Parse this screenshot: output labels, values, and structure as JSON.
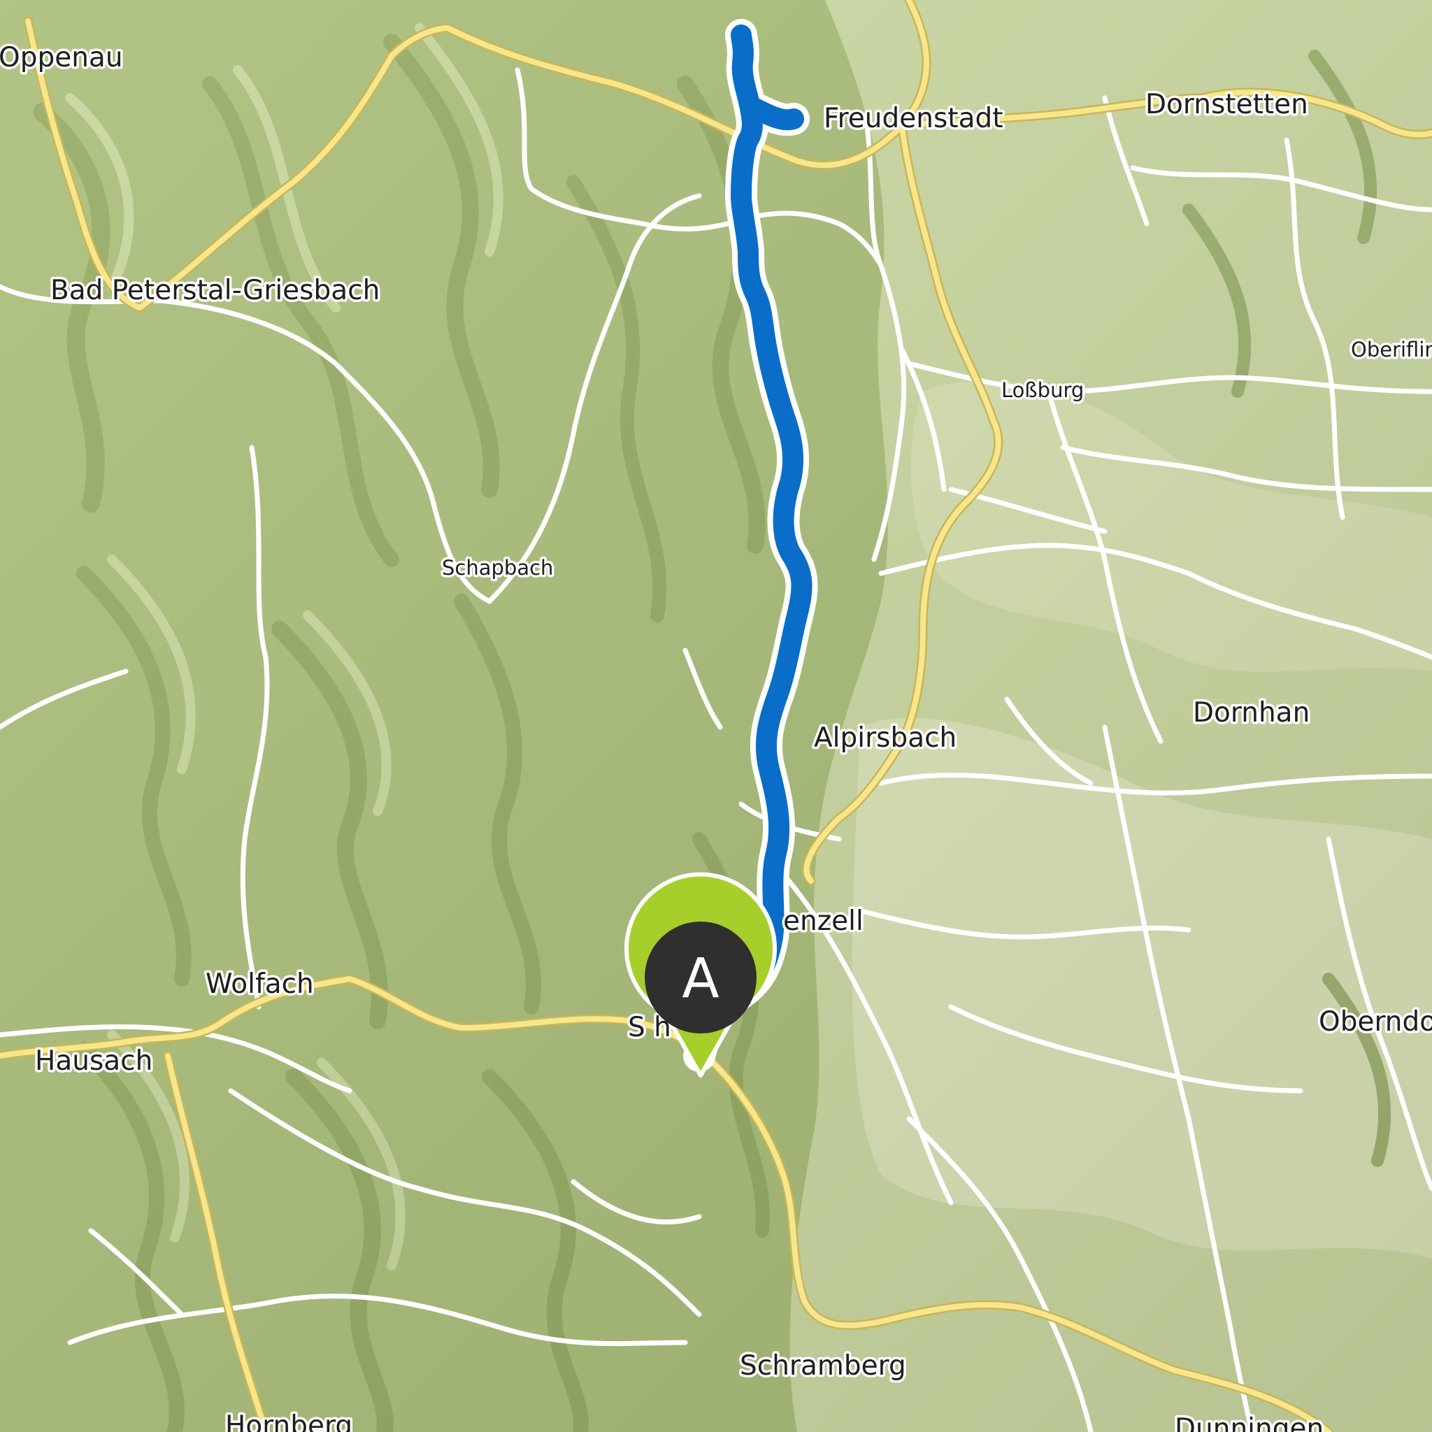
{
  "map": {
    "places": [
      {
        "id": "oppenau",
        "name": "Oppenau"
      },
      {
        "id": "freudenstadt",
        "name": "Freudenstadt"
      },
      {
        "id": "dornstetten",
        "name": "Dornstetten"
      },
      {
        "id": "bad-peterstal",
        "name": "Bad Peterstal-Griesbach"
      },
      {
        "id": "obeiflin",
        "name": "Oberiflin"
      },
      {
        "id": "lossburg",
        "name": "Loßburg"
      },
      {
        "id": "schapbach",
        "name": "Schapbach"
      },
      {
        "id": "dornhan",
        "name": "Dornhan"
      },
      {
        "id": "alpirsbach",
        "name": "Alpirsbach"
      },
      {
        "id": "ehlenzell",
        "name": "enzell"
      },
      {
        "id": "wolfach",
        "name": "Wolfach"
      },
      {
        "id": "schiltach",
        "name": "S          h"
      },
      {
        "id": "hausach",
        "name": "Hausach"
      },
      {
        "id": "oberndorf",
        "name": "Oberndo"
      },
      {
        "id": "schramberg",
        "name": "Schramberg"
      },
      {
        "id": "hornberg",
        "name": "Hornberg"
      },
      {
        "id": "dunningen",
        "name": "Dunningen"
      }
    ],
    "route": {
      "color": "#0a6ec9",
      "outline": "#ffffff"
    },
    "start_marker": {
      "letter": "A",
      "ring_color": "#a7cf2b",
      "fill_color": "#2f2f2f"
    },
    "colors": {
      "terrain": "#cbd9a2",
      "forest": "#a4bb72",
      "road_major": "#f6e58b",
      "road_minor": "#ffffff"
    }
  }
}
